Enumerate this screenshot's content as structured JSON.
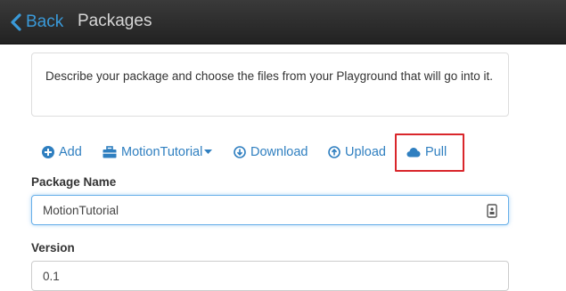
{
  "header": {
    "back_label": "Back",
    "title": "Packages"
  },
  "description": "Describe your package and choose the files from your Playground that will go into it.",
  "toolbar": {
    "add_label": "Add",
    "package_select_label": "MotionTutorial",
    "download_label": "Download",
    "upload_label": "Upload",
    "pull_label": "Pull"
  },
  "form": {
    "package_name_label": "Package Name",
    "package_name_value": "MotionTutorial",
    "version_label": "Version",
    "version_value": "0.1"
  },
  "colors": {
    "accent": "#2f7fc0",
    "highlight": "#d9262b",
    "topbar": "#2a2a2a"
  }
}
